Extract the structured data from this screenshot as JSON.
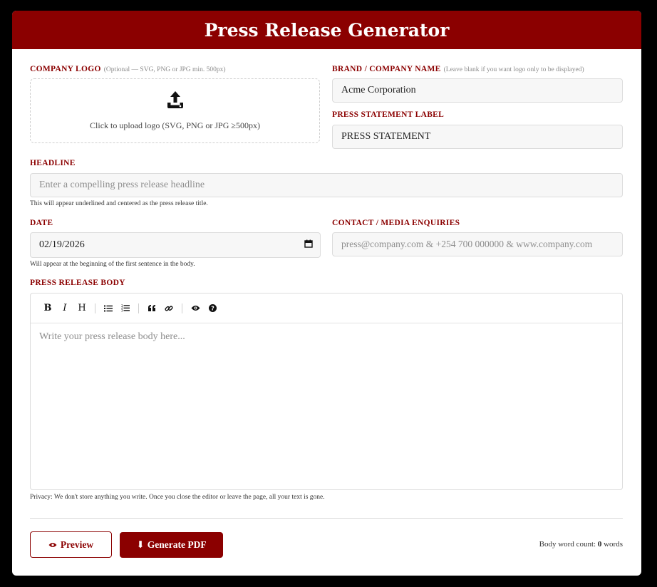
{
  "header": {
    "title": "Press Release Generator"
  },
  "logo": {
    "label": "COMPANY LOGO",
    "hint": "(Optional — SVG, PNG or JPG min. 500px)",
    "upload_text": "Click to upload logo (SVG, PNG or JPG ≥500px)",
    "icon": "upload-icon"
  },
  "brand": {
    "label": "BRAND / COMPANY NAME",
    "hint": "(Leave blank if you want logo only to be displayed)",
    "value": "Acme Corporation"
  },
  "statement": {
    "label": "PRESS STATEMENT LABEL",
    "value": "PRESS STATEMENT"
  },
  "headline": {
    "label": "HEADLINE",
    "placeholder": "Enter a compelling press release headline",
    "helper": "This will appear underlined and centered as the press release title."
  },
  "date": {
    "label": "DATE",
    "value": "02/19/2026",
    "helper": "Will appear at the beginning of the first sentence in the body.",
    "icon": "calendar-icon"
  },
  "contact": {
    "label": "CONTACT / MEDIA ENQUIRIES",
    "placeholder": "press@company.com & +254 700 000000 & www.company.com"
  },
  "body": {
    "label": "PRESS RELEASE BODY",
    "placeholder": "Write your press release body here...",
    "privacy": "Privacy: We don't store anything you write. Once you close the editor or leave the page, all your text is gone.",
    "toolbar": {
      "bold": "B",
      "italic": "I",
      "heading": "H"
    }
  },
  "actions": {
    "preview_label": "Preview",
    "generate_label": "Generate PDF",
    "word_count_prefix": "Body word count:",
    "word_count": "0",
    "word_count_suffix": "words"
  },
  "colors": {
    "accent": "#8b0000",
    "background": "#000000"
  }
}
